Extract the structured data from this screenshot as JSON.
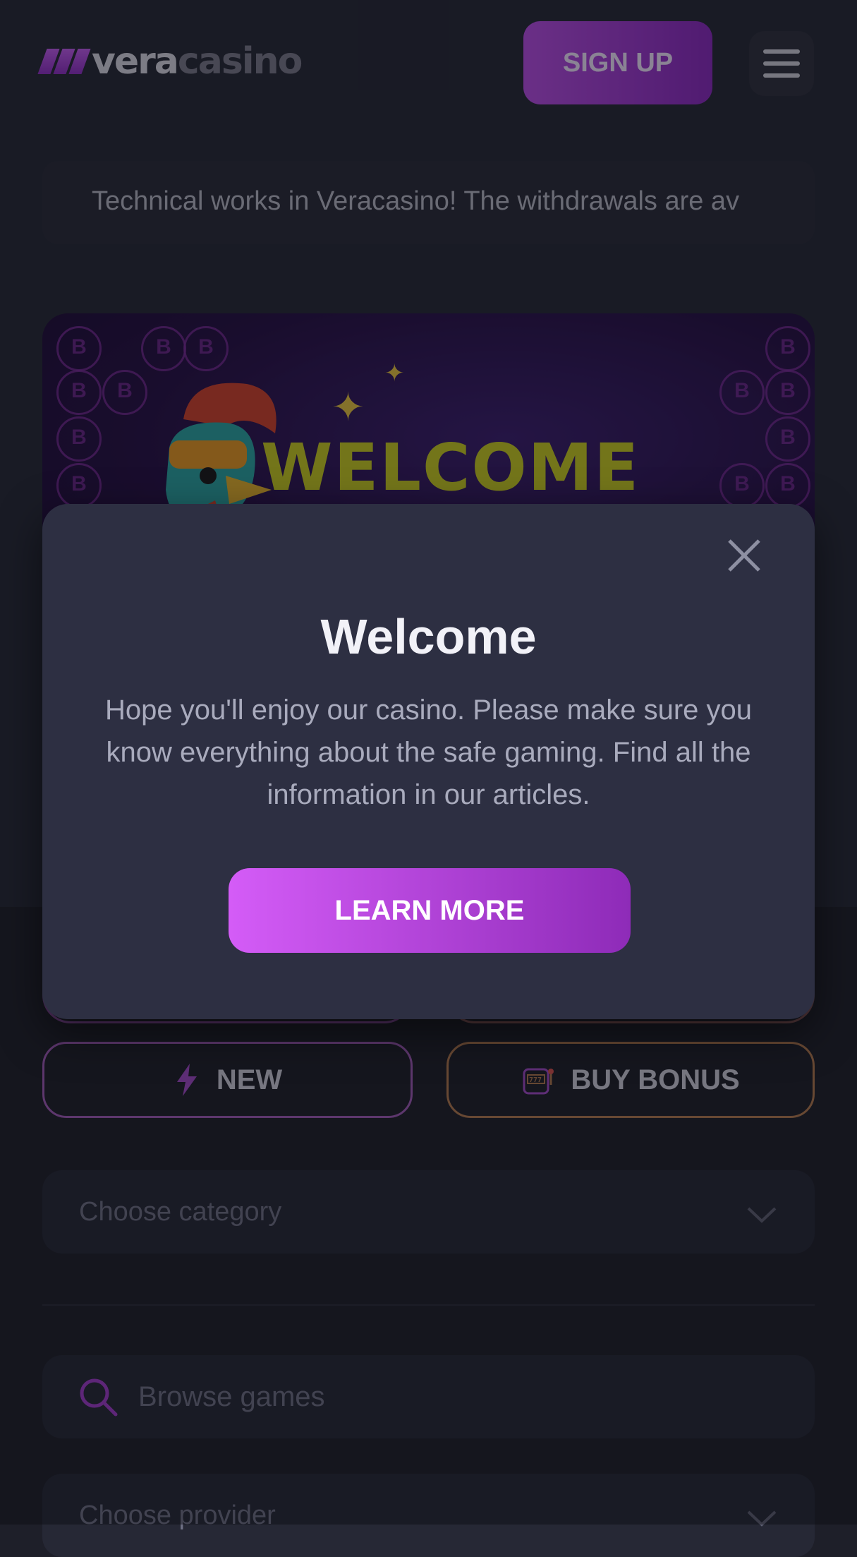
{
  "header": {
    "logo_part1": "vera",
    "logo_part2": "casino",
    "signup_label": "SIGN UP",
    "menu_icon": "hamburger-icon"
  },
  "ticker": {
    "text": "Technical works in Veracasino! The withdrawals are av"
  },
  "banner": {
    "title": "WELCOME"
  },
  "modal": {
    "title": "Welcome",
    "body": "Hope you'll enjoy our casino. Please make sure you know everything about the safe gaming. Find all the information in our articles.",
    "cta_label": "LEARN MORE",
    "close_icon": "close-icon"
  },
  "filters": {
    "new_label": "NEW",
    "new_icon": "lightning-icon",
    "buy_bonus_label": "BUY BONUS",
    "buy_bonus_icon": "slot-machine-icon"
  },
  "category_select": {
    "placeholder": "Choose category"
  },
  "search": {
    "placeholder": "Browse games",
    "icon": "search-icon"
  },
  "provider_select": {
    "placeholder": "Choose provider"
  },
  "colors": {
    "accent_purple": "#b94ee6",
    "banner_yellow": "#c8cd22",
    "background": "#1e1f29"
  }
}
